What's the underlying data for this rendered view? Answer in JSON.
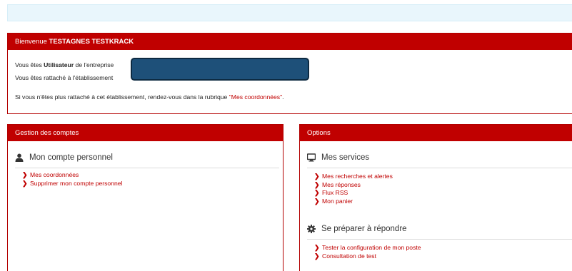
{
  "welcome": {
    "heading_prefix": "Bienvenue ",
    "heading_name": "TESTAGNES TESTKRACK",
    "line1_pre": "Vous êtes ",
    "line1_role": "Utilisateur",
    "line1_post": " de l'entreprise",
    "line2": "Vous êtes rattaché à l'établissement",
    "line3_pre": "Si vous n'êtes plus rattaché à cet établissement, rendez-vous dans la rubrique ",
    "line3_link": "\"Mes coordonnées\"",
    "line3_post": "."
  },
  "accounts": {
    "heading": "Gestion des comptes",
    "section_title": "Mon compte personnel",
    "section_icon": "user-icon",
    "links": [
      "Mes coordonnées",
      "Supprimer mon compte personnel"
    ]
  },
  "options": {
    "heading": "Options",
    "services": {
      "title": "Mes services",
      "icon": "monitor-icon",
      "links": [
        "Mes recherches et alertes",
        "Mes réponses",
        "Flux RSS",
        "Mon panier"
      ]
    },
    "prepare": {
      "title": "Se préparer à répondre",
      "icon": "gear-icon",
      "links": [
        "Tester la configuration de mon poste",
        "Consultation de test"
      ]
    }
  },
  "colors": {
    "accent": "#c00000",
    "info_bg": "#e9f6fc",
    "redaction": "#1e5079"
  }
}
